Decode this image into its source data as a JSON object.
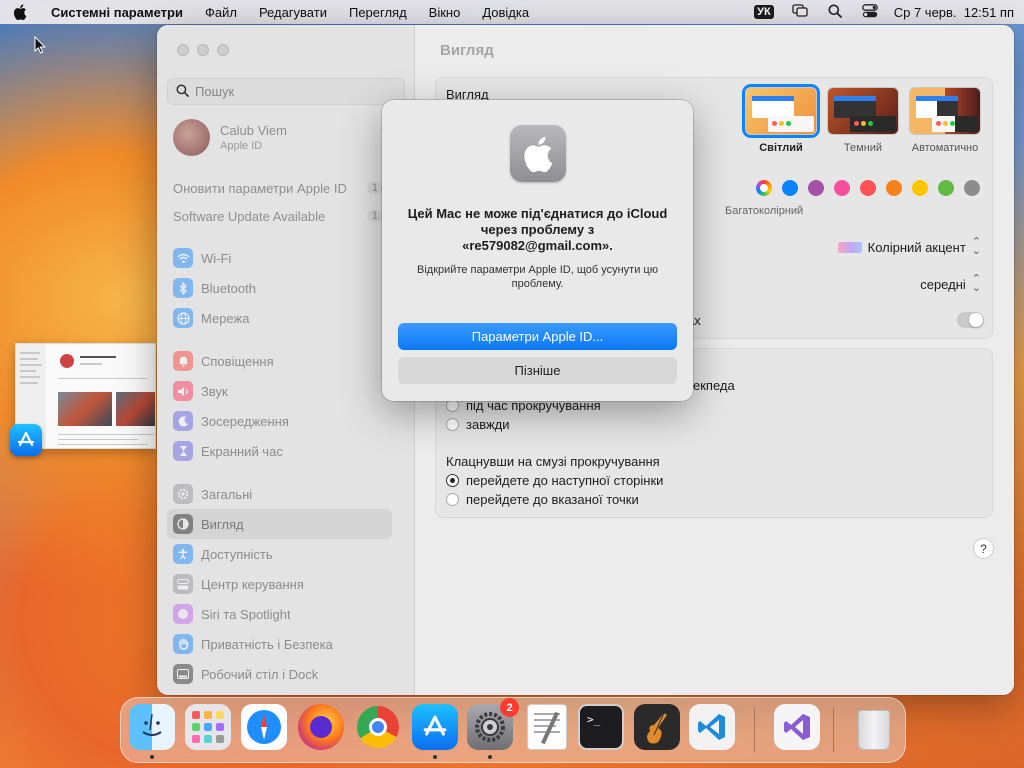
{
  "menubar": {
    "app_name": "Системні параметри",
    "items": [
      "Файл",
      "Редагувати",
      "Перегляд",
      "Вікно",
      "Довідка"
    ],
    "keyboard_layout": "УК",
    "datetime": "Ср 7 черв.  12:51 пп"
  },
  "sidebar": {
    "search_placeholder": "Пошук",
    "account_name": "Calub Viem",
    "account_sub": "Apple ID",
    "notices": [
      {
        "label": "Оновити параметри Apple ID",
        "count": "1"
      },
      {
        "label": "Software Update Available",
        "count": "1"
      }
    ],
    "group1": [
      {
        "label": "Wi-Fi",
        "icon": "wifi-icon",
        "color": "#0a84ff"
      },
      {
        "label": "Bluetooth",
        "icon": "bluetooth-icon",
        "color": "#0a84ff"
      },
      {
        "label": "Мережа",
        "icon": "globe-icon",
        "color": "#0a84ff"
      }
    ],
    "group2": [
      {
        "label": "Сповіщення",
        "icon": "bell-icon",
        "color": "#ff3b30"
      },
      {
        "label": "Звук",
        "icon": "speaker-icon",
        "color": "#ff2d55"
      },
      {
        "label": "Зосередження",
        "icon": "moon-icon",
        "color": "#5e5ce6"
      },
      {
        "label": "Екранний час",
        "icon": "hourglass-icon",
        "color": "#5e5ce6"
      }
    ],
    "group3": [
      {
        "label": "Загальні",
        "icon": "gear-icon",
        "color": "#8e8e93"
      },
      {
        "label": "Вигляд",
        "icon": "appearance-icon",
        "color": "#1d1d1f",
        "active": true
      },
      {
        "label": "Доступність",
        "icon": "accessibility-icon",
        "color": "#0a84ff"
      },
      {
        "label": "Центр керування",
        "icon": "control-center-icon",
        "color": "#8e8e93"
      },
      {
        "label": "Siri та Spotlight",
        "icon": "siri-icon",
        "color": "#bf5af2"
      },
      {
        "label": "Приватність і Безпека",
        "icon": "hand-icon",
        "color": "#0a84ff"
      },
      {
        "label": "Робочий стіл і Dock",
        "icon": "dock-icon",
        "color": "#1d1d1f"
      }
    ]
  },
  "main": {
    "title": "Вигляд",
    "appearance_label": "Вигляд",
    "themes": [
      {
        "label": "Світлий",
        "selected": true
      },
      {
        "label": "Темний",
        "selected": false
      },
      {
        "label": "Автоматично",
        "selected": false
      }
    ],
    "accent_colors": [
      "multicolor",
      "#0a84ff",
      "#a550a7",
      "#f74f9e",
      "#ff5257",
      "#f7821b",
      "#ffc600",
      "#62ba46",
      "#8c8c8c"
    ],
    "accent_multi_label": "Багатоколірний",
    "highlight_label": "Колірний акцент",
    "sidebar_size_value": "середні",
    "partial_text": "ах",
    "scroll_partial": "екпеда",
    "scroll_options": [
      "під час прокручування",
      "завжди"
    ],
    "click_group_label": "Клацнувши на смузі прокручування",
    "click_options": [
      {
        "label": "перейдете до наступної сторінки",
        "selected": true
      },
      {
        "label": "перейдете до вказаної точки",
        "selected": false
      }
    ],
    "help": "?"
  },
  "dialog": {
    "title": "Цей Mac не може під'єднатися до iCloud через проблему з «re579082@gmail.com».",
    "message": "Відкрийте параметри Apple ID, щоб усунути цю проблему.",
    "primary_button": "Параметри Apple ID...",
    "secondary_button": "Пізніше"
  },
  "dock": {
    "apps": [
      {
        "name": "Finder",
        "icon": "finder-icon",
        "running": true
      },
      {
        "name": "Launchpad",
        "icon": "launchpad-icon",
        "running": false
      },
      {
        "name": "Safari",
        "icon": "safari-icon",
        "running": false
      },
      {
        "name": "Firefox",
        "icon": "firefox-icon",
        "running": false
      },
      {
        "name": "Chrome",
        "icon": "chrome-icon",
        "running": false
      },
      {
        "name": "App Store",
        "icon": "appstore-icon",
        "running": true
      },
      {
        "name": "System Settings",
        "icon": "settings-icon",
        "running": true,
        "badge": "2"
      },
      {
        "name": "TextEdit",
        "icon": "textedit-icon",
        "running": false
      },
      {
        "name": "Terminal",
        "icon": "terminal-icon",
        "running": false
      },
      {
        "name": "GarageBand",
        "icon": "garageband-icon",
        "running": false
      },
      {
        "name": "VS Code",
        "icon": "vscode-icon",
        "running": false
      },
      {
        "name": "Visual Studio",
        "icon": "visualstudio-icon",
        "running": false
      },
      {
        "name": "Trash",
        "icon": "trash-icon",
        "running": false
      }
    ]
  }
}
